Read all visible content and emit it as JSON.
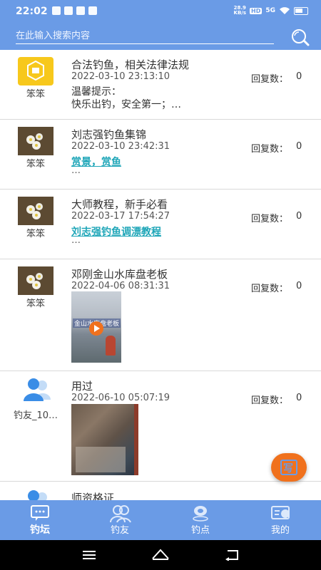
{
  "status_bar": {
    "time": "22:02",
    "net_speed": "28.9\nKB/s",
    "hd": "HD",
    "signal": "5G"
  },
  "search": {
    "placeholder": "在此输入搜索内容"
  },
  "reply_label": "回复数：",
  "posts": [
    {
      "author": "笨笨",
      "title": "合法钓鱼，相关法律法规",
      "date": "2022-03-10 23:13:10",
      "replies": "0",
      "text_line1": "温馨提示：",
      "text_line2": "快乐出钓，安全第一；…"
    },
    {
      "author": "笨笨",
      "title": "刘志强钓鱼集锦",
      "date": "2022-03-10 23:42:31",
      "replies": "0",
      "link": "赏景，赏鱼",
      "ellipsis": "…"
    },
    {
      "author": "笨笨",
      "title": "大师教程，新手必看",
      "date": "2022-03-17 17:54:27",
      "replies": "0",
      "link": "刘志强钓鱼调漂教程",
      "ellipsis": "…"
    },
    {
      "author": "笨笨",
      "title": "邓刚金山水库盘老板",
      "date": "2022-04-06 08:31:31",
      "replies": "0",
      "video_caption": "金山水库盘老板"
    },
    {
      "author": "钓友_10…",
      "title": "用过",
      "date": "2022-06-10 05:07:19",
      "replies": "0"
    },
    {
      "title": "师资格证"
    }
  ],
  "fab": {
    "label": "写"
  },
  "tabs": [
    {
      "label": "钓坛",
      "icon": "chat-icon",
      "active": true
    },
    {
      "label": "钓友",
      "icon": "friends-icon",
      "active": false
    },
    {
      "label": "钓点",
      "icon": "location-icon",
      "active": false
    },
    {
      "label": "我的",
      "icon": "profile-card-icon",
      "active": false
    }
  ],
  "colors": {
    "primary": "#6a9be6",
    "accent": "#f0711d",
    "link": "#1fa6b8"
  }
}
